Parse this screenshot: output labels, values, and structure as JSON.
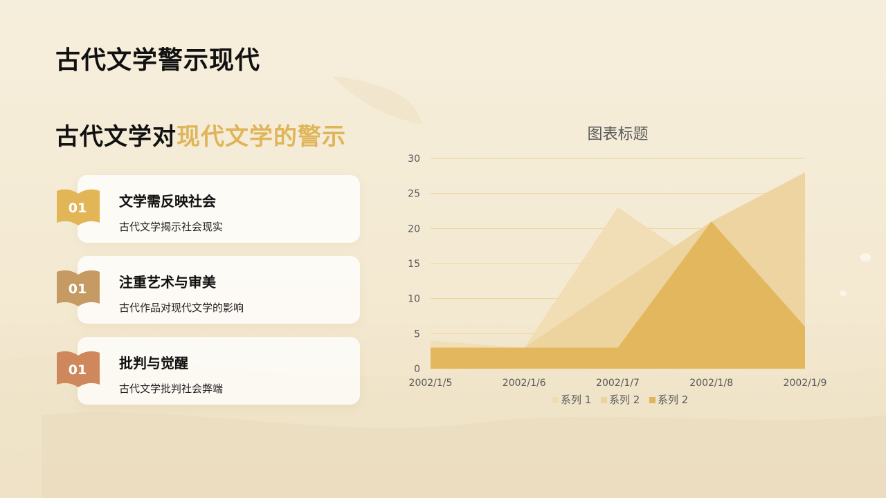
{
  "header": {
    "title": "古代文学警示现代"
  },
  "subtitle": {
    "text_plain": "古代文学对",
    "text_highlight": "现代文学的警示"
  },
  "cards": [
    {
      "num": "01",
      "title": "文学需反映社会",
      "desc": "古代文学揭示社会现实",
      "color": "#e2b556"
    },
    {
      "num": "01",
      "title": "注重艺术与审美",
      "desc": "古代作品对现代文学的影响",
      "color": "#c59a63"
    },
    {
      "num": "01",
      "title": "批判与觉醒",
      "desc": "古代文学批判社会弊端",
      "color": "#cf875c"
    }
  ],
  "chart_data": {
    "type": "area",
    "title": "图表标题",
    "categories": [
      "2002/1/5",
      "2002/1/6",
      "2002/1/7",
      "2002/1/8",
      "2002/1/9"
    ],
    "ylim": [
      0,
      30
    ],
    "yticks": [
      0,
      5,
      10,
      15,
      20,
      25,
      30
    ],
    "grid": true,
    "legend_position": "bottom",
    "series": [
      {
        "name": "系列 1",
        "values": [
          4,
          3,
          23,
          14,
          6
        ],
        "color": "#f0dcb0"
      },
      {
        "name": "系列 2",
        "values": [
          3,
          3,
          12,
          21,
          28
        ],
        "color": "#ecd39e"
      },
      {
        "name": "系列 2",
        "values": [
          3,
          3,
          3,
          21,
          6
        ],
        "color": "#e2b55b"
      }
    ]
  }
}
